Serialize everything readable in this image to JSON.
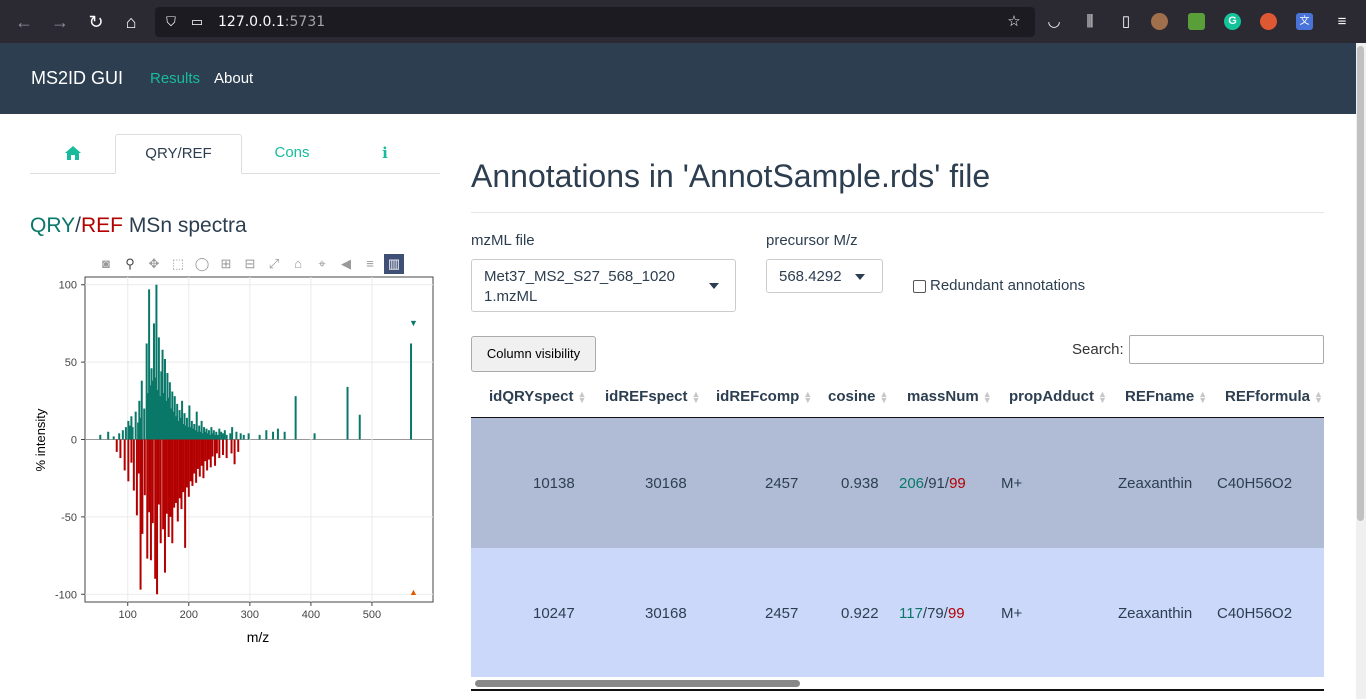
{
  "browser": {
    "url_host": "127.0.0.1",
    "url_port": ":5731"
  },
  "app": {
    "brand": "MS2ID GUI",
    "nav": [
      "Results",
      "About"
    ]
  },
  "left_panel": {
    "tabs": [
      "QRY/REF",
      "Cons"
    ],
    "active_tab": "QRY/REF",
    "title_qry": "QRY",
    "title_slash": "/",
    "title_ref": "REF",
    "title_rest": " MSn spectra"
  },
  "chart_data": {
    "type": "bar",
    "xlabel": "m/z",
    "ylabel": "% intensity",
    "xlim": [
      30,
      600
    ],
    "ylim": [
      -105,
      105
    ],
    "x_ticks": [
      100,
      200,
      300,
      400,
      500
    ],
    "y_ticks": [
      100,
      50,
      0,
      -50,
      -100
    ],
    "grid": true,
    "series": [
      {
        "colors": "#0a7869",
        "x": [
          55,
          68,
          77,
          86,
          92,
          97,
          101,
          103,
          106,
          108,
          113,
          117,
          119,
          121,
          123,
          127,
          131,
          133,
          135,
          137,
          139,
          141,
          143,
          145,
          147,
          149,
          151,
          153,
          155,
          157,
          159,
          161,
          163,
          165,
          167,
          169,
          171,
          173,
          175,
          177,
          179,
          181,
          183,
          185,
          187,
          189,
          191,
          193,
          195,
          197,
          199,
          201,
          203,
          205,
          207,
          209,
          211,
          213,
          215,
          217,
          219,
          221,
          223,
          225,
          227,
          229,
          231,
          233,
          235,
          237,
          239,
          241,
          243,
          245,
          247,
          250,
          253,
          256,
          259,
          262,
          268,
          271,
          278,
          285,
          290,
          298,
          316,
          327,
          338,
          346,
          357,
          375,
          406,
          460,
          480,
          564
        ],
        "y": [
          3,
          5,
          2,
          4,
          6,
          8,
          12,
          9,
          15,
          8,
          18,
          11,
          25,
          14,
          38,
          20,
          62,
          30,
          97,
          35,
          46,
          38,
          75,
          40,
          100,
          32,
          66,
          28,
          44,
          58,
          30,
          52,
          25,
          43,
          27,
          37,
          20,
          31,
          18,
          28,
          15,
          23,
          12,
          19,
          14,
          25,
          10,
          17,
          9,
          14,
          8,
          22,
          8,
          12,
          7,
          10,
          6,
          18,
          5,
          9,
          5,
          12,
          4,
          8,
          5,
          7,
          4,
          6,
          3,
          8,
          4,
          6,
          3,
          5,
          3,
          7,
          5,
          4,
          6,
          3,
          4,
          8,
          5,
          4,
          3,
          4,
          3,
          6,
          5,
          7,
          5,
          28,
          4,
          34,
          16,
          62
        ]
      },
      {
        "colors": "#b30000",
        "x": [
          82,
          88,
          95,
          101,
          106,
          110,
          115,
          118,
          121,
          124,
          128,
          132,
          135,
          138,
          141,
          145,
          148,
          151,
          154,
          158,
          161,
          164,
          167,
          170,
          173,
          176,
          179,
          182,
          185,
          188,
          191,
          194,
          197,
          200,
          203,
          206,
          209,
          212,
          215,
          218,
          221,
          224,
          227,
          230,
          233,
          236,
          239,
          243,
          246,
          250,
          256,
          262,
          270,
          275,
          281
        ],
        "y": [
          -8,
          -12,
          -20,
          -27,
          -15,
          -33,
          -49,
          -22,
          -97,
          -61,
          -36,
          -77,
          -47,
          -78,
          -54,
          -90,
          -100,
          -42,
          -67,
          -58,
          -86,
          -48,
          -63,
          -50,
          -67,
          -44,
          -41,
          -53,
          -38,
          -45,
          -34,
          -70,
          -31,
          -37,
          -27,
          -30,
          -22,
          -28,
          -19,
          -24,
          -17,
          -25,
          -14,
          -20,
          -13,
          -18,
          -11,
          -17,
          -9,
          -12,
          -10,
          -12,
          -9,
          -16,
          -8
        ]
      }
    ],
    "markers": [
      {
        "x": 568,
        "y": 76,
        "color": "#0a7869",
        "label": "▼"
      },
      {
        "x": 568,
        "y": -98,
        "color": "#e05a00",
        "label": "▲"
      }
    ]
  },
  "right_panel": {
    "title": "Annotations in 'AnnotSample.rds' file",
    "mzml_label": "mzML file",
    "mzml_value_line1": "Met37_MS2_S27_568_1020",
    "mzml_value_line2": "1.mzML",
    "precursor_label": "precursor M/z",
    "precursor_value": "568.4292",
    "redundant_label": "Redundant annotations",
    "column_visibility": "Column visibility",
    "search_label": "Search:",
    "columns": [
      "idQRYspect",
      "idREFspect",
      "idREFcomp",
      "cosine",
      "massNum",
      "propAdduct",
      "REFname",
      "REFformula"
    ],
    "rows": [
      {
        "idQRYspect": "10138",
        "idREFspect": "30168",
        "idREFcomp": "2457",
        "cosine": "0.938",
        "mn1": "206",
        "mn_sep1": "/",
        "mn2": "91",
        "mn_sep2": "/",
        "mn3": "99",
        "propAdduct": "M+",
        "REFname": "Zeaxanthin",
        "REFformula": "C40H56O2",
        "bg": "#b0bcd6"
      },
      {
        "idQRYspect": "10247",
        "idREFspect": "30168",
        "idREFcomp": "2457",
        "cosine": "0.922",
        "mn1": "117",
        "mn_sep1": "/",
        "mn2": "79",
        "mn_sep2": "/",
        "mn3": "99",
        "propAdduct": "M+",
        "REFname": "Zeaxanthin",
        "REFformula": "C40H56O2",
        "bg": "#cbd8fa"
      }
    ]
  }
}
